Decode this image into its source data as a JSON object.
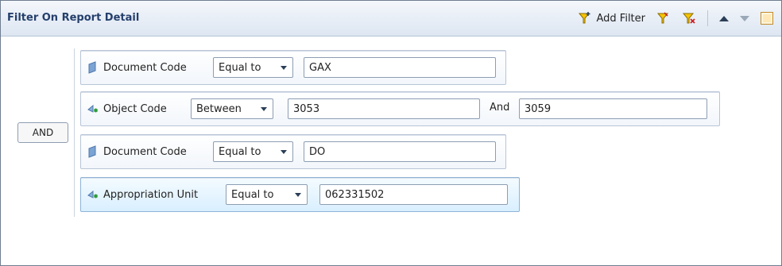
{
  "panel": {
    "title": "Filter On Report Detail"
  },
  "toolbar": {
    "add_filter_label": "Add Filter",
    "icons": [
      "add-filter-icon",
      "filter-edit-icon",
      "filter-remove-icon",
      "move-up-icon",
      "move-down-icon",
      "toggle-panel-icon"
    ]
  },
  "logic": {
    "operator_label": "AND"
  },
  "filters": [
    {
      "field": "Document Code",
      "operator": "Equal to",
      "value": "GAX",
      "icon": "dimension-icon"
    },
    {
      "field": "Object Code",
      "operator": "Between",
      "value_from": "3053",
      "and_label": "And",
      "value_to": "3059",
      "icon": "measure-object-icon"
    },
    {
      "field": "Document Code",
      "operator": "Equal to",
      "value": "DO",
      "icon": "dimension-icon"
    },
    {
      "field": "Appropriation Unit",
      "operator": "Equal to",
      "value": "062331502",
      "icon": "measure-object-icon",
      "selected": true
    }
  ],
  "colors": {
    "title": "#253f6c",
    "header_bg": "#dde6f2",
    "row_border": "#b8c5d6",
    "selected_row_bg": "#d9efff"
  }
}
